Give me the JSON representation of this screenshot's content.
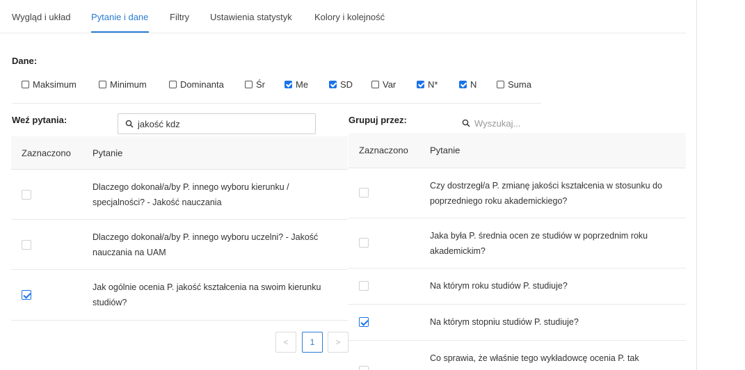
{
  "tabs": {
    "appearance": "Wygląd i układ",
    "questions_data": "Pytanie i dane",
    "filters": "Filtry",
    "stats_settings": "Ustawienia statystyk",
    "colors_order": "Kolory i kolejność"
  },
  "data_section": {
    "label": "Dane:",
    "stats": [
      {
        "label": "Maksimum",
        "checked": false
      },
      {
        "label": "Minimum",
        "checked": false
      },
      {
        "label": "Dominanta",
        "checked": false
      },
      {
        "label": "Śr",
        "checked": false
      },
      {
        "label": "Me",
        "checked": true
      },
      {
        "label": "SD",
        "checked": true
      },
      {
        "label": "Var",
        "checked": false
      },
      {
        "label": "N*",
        "checked": true
      },
      {
        "label": "N",
        "checked": true
      },
      {
        "label": "Suma",
        "checked": false
      }
    ]
  },
  "questions": {
    "label": "Weź pytania:",
    "search_value": "jakość kdz",
    "col_selected": "Zaznaczono",
    "col_question": "Pytanie",
    "rows": [
      {
        "text": "Dlaczego dokonał/a/by P. innego wyboru kierunku / specjalności? - Jakość nauczania",
        "checked": false
      },
      {
        "text": "Dlaczego dokonał/a/by P. innego wyboru uczelni? - Jakość nauczania na UAM",
        "checked": false
      },
      {
        "text": "Jak ogólnie ocenia P. jakość kształcenia na swoim kierunku studiów?",
        "checked": true
      }
    ]
  },
  "group_by": {
    "label": "Grupuj przez:",
    "search_placeholder": "Wyszukaj...",
    "col_selected": "Zaznaczono",
    "col_question": "Pytanie",
    "rows": [
      {
        "text": "Czy dostrzegł/a P. zmianę jakości kształcenia w stosunku do poprzedniego roku akademickiego?",
        "checked": false
      },
      {
        "text": "Jaka była P. średnia ocen ze studiów w poprzednim roku akademickim?",
        "checked": false
      },
      {
        "text": "Na którym roku studiów P. studiuje?",
        "checked": false
      },
      {
        "text": "Na którym stopniu studiów P. studiuje?",
        "checked": true
      },
      {
        "text": "Co sprawia, że właśnie tego wykładowcę ocenia P. tak",
        "checked": false
      }
    ]
  },
  "pagination": {
    "prev": "<",
    "current": "1",
    "next": ">"
  },
  "colors": {
    "accent": "#2b7cd3",
    "checkbox_blue": "#1a73e8"
  }
}
